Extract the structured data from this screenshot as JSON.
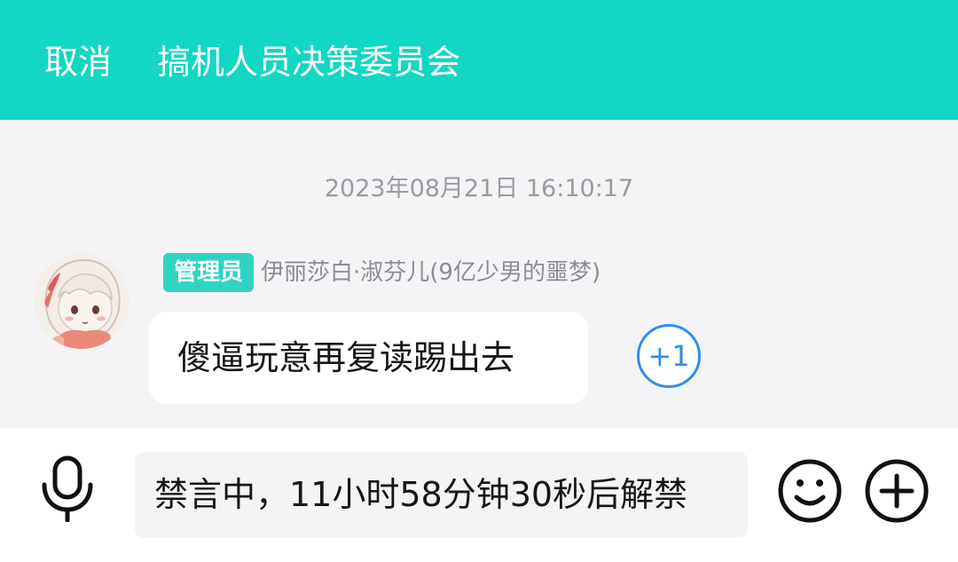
{
  "header": {
    "cancel_label": "取消",
    "title": "搞机人员决策委员会",
    "background_color": "#12d7c2"
  },
  "chat": {
    "timestamp": "2023年08月21日 16:10:17",
    "message": {
      "badge": "管理员",
      "sender": "伊丽莎白·淑芬儿(9亿少男的噩梦)",
      "text": "傻逼玩意再复读踢出去",
      "avatar_icon": "anime-avatar",
      "plus_one_label": "+1"
    }
  },
  "input_bar": {
    "mic_icon": "microphone-icon",
    "muted_text": "禁言中，11小时58分钟30秒后解禁",
    "emoji_icon": "smiley-icon",
    "plus_icon": "plus-circle-icon"
  },
  "colors": {
    "accent": "#12d7c2",
    "badge": "#2fd3c4",
    "plus_one": "#2d8ef0"
  }
}
